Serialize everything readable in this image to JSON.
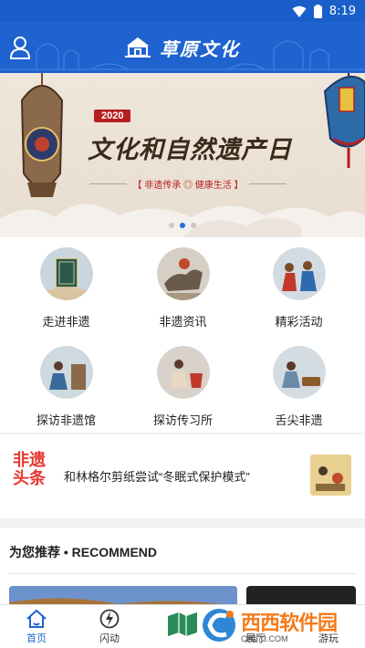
{
  "status_bar": {
    "time": "8:19"
  },
  "header": {
    "title": "草原文化"
  },
  "banner": {
    "year": "2020",
    "title": "文化和自然遗产日",
    "subtitle": "【 非遗传承 ◎ 健康生活 】",
    "page_count": 3,
    "active_page": 2
  },
  "grid": {
    "items": [
      {
        "label": "走进非遗"
      },
      {
        "label": "非遗资讯"
      },
      {
        "label": "精彩活动"
      },
      {
        "label": "探访非遗馆"
      },
      {
        "label": "探访传习所"
      },
      {
        "label": "舌尖非遗"
      }
    ]
  },
  "headline": {
    "tag_line1": "非遗",
    "tag_line2": "头条",
    "text": "和林格尔剪纸尝试“冬眠式保护模式”"
  },
  "recommend": {
    "heading": "为您推荐 • RECOMMEND"
  },
  "tabbar": {
    "tabs": [
      {
        "label": "首页"
      },
      {
        "label": "闪动"
      },
      {
        "label": "展厅"
      },
      {
        "label": "游玩"
      }
    ]
  },
  "watermark": {
    "name": "西西软件园",
    "url": "CR173.COM"
  },
  "colors": {
    "primary": "#1e63cf",
    "accent_red": "#e8382f",
    "banner_red": "#b81e1e"
  }
}
